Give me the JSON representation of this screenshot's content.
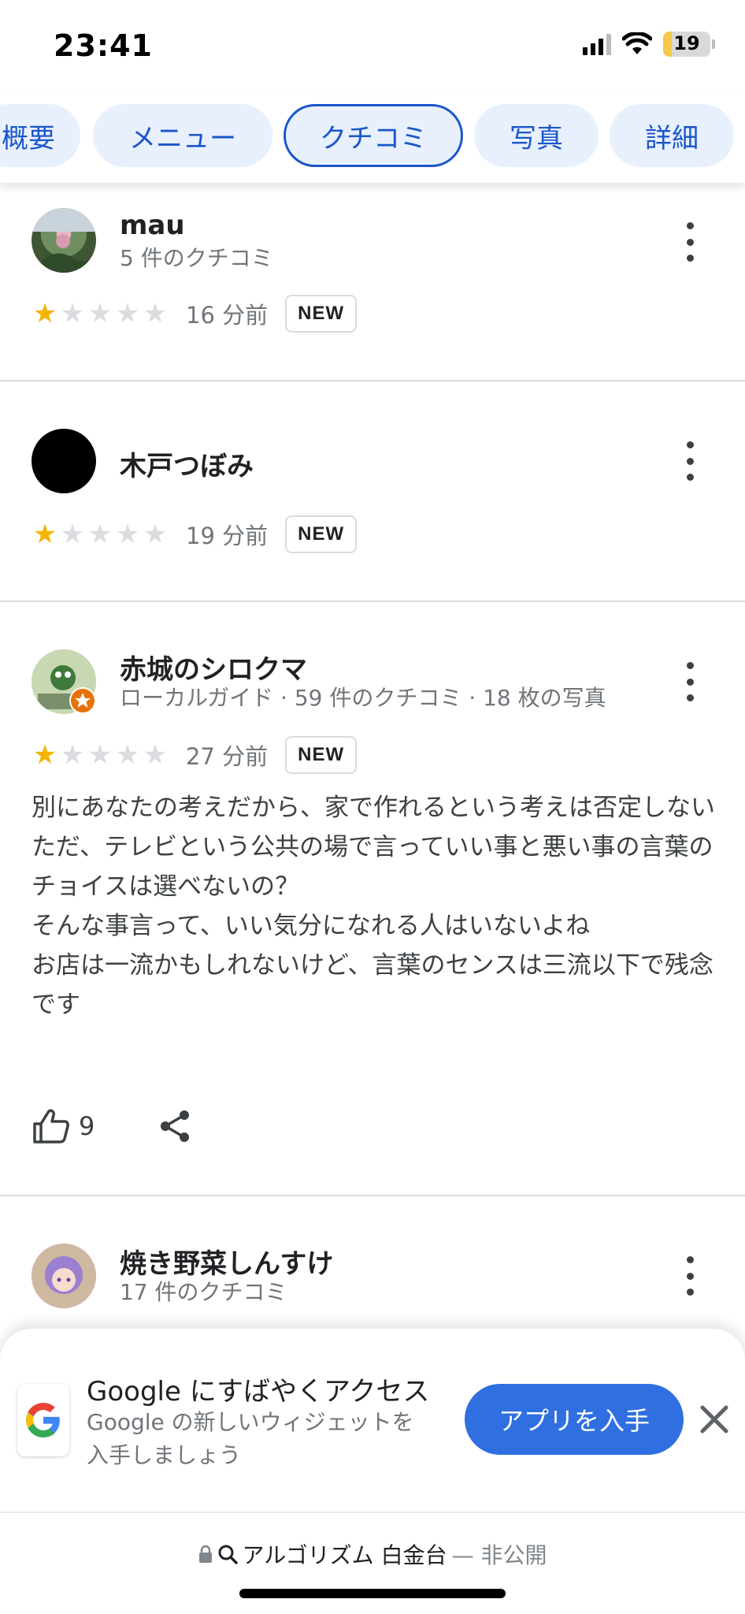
{
  "status": {
    "time": "23:41",
    "battery": "19",
    "battery_level": 0.19
  },
  "tabs": [
    {
      "label": "概要",
      "active": false
    },
    {
      "label": "メニュー",
      "active": false
    },
    {
      "label": "クチコミ",
      "active": true
    },
    {
      "label": "写真",
      "active": false
    },
    {
      "label": "詳細",
      "active": false
    }
  ],
  "reviews": [
    {
      "name": "mau",
      "meta": "5 件のクチコミ",
      "rating": 1,
      "time": "16 分前",
      "badge": "NEW"
    },
    {
      "name": "木戸つぼみ",
      "meta": "",
      "rating": 1,
      "time": "19 分前",
      "badge": "NEW"
    },
    {
      "name": "赤城のシロクマ",
      "meta": "ローカルガイド · 59 件のクチコミ · 18 枚の写真",
      "rating": 1,
      "time": "27 分前",
      "badge": "NEW",
      "body": "別にあなたの考えだから、家で作れるという考えは否定しない\nただ、テレビという公共の場で言っていい事と悪い事の言葉のチョイスは選べないの？\nそんな事言って、いい気分になれる人はいないよね\nお店は一流かもしれないけど、言葉のセンスは三流以下で残念です",
      "likes": "9"
    },
    {
      "name": "焼き野菜しんすけ",
      "meta": "17 件のクチコミ"
    }
  ],
  "banner": {
    "title": "Google にすばやくアクセス",
    "subtitle": "Google の新しいウィジェットを入手しましょう",
    "button": "アプリを入手"
  },
  "address": {
    "domain": "アルゴリズム 白金台",
    "suffix": "— 非公開"
  },
  "icons": {
    "star": "★",
    "like": "thumbs-up-icon",
    "share": "share-icon",
    "lock": "lock-icon",
    "search": "search-icon",
    "close": "close-icon"
  },
  "colors": {
    "accent": "#1a56c9",
    "star": "#f4b400",
    "button": "#2f6fe0"
  }
}
